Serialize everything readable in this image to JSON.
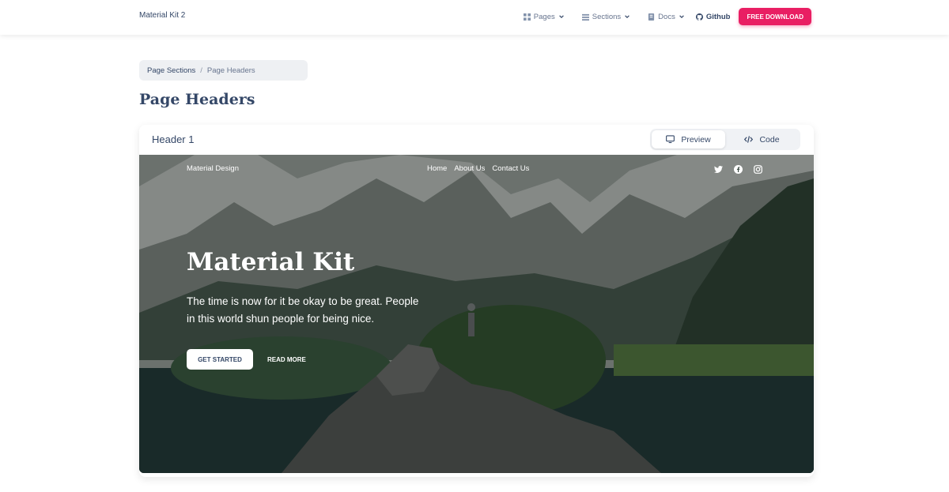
{
  "navbar": {
    "brand": "Material Kit 2",
    "items": [
      {
        "label": "Pages",
        "icon": "grid-icon"
      },
      {
        "label": "Sections",
        "icon": "list-icon"
      },
      {
        "label": "Docs",
        "icon": "book-icon"
      }
    ],
    "github_label": "Github",
    "download_label": "FREE DOWNLOAD",
    "accent_color": "#e91e63"
  },
  "breadcrumb": {
    "parent": "Page Sections",
    "separator": "/",
    "current": "Page Headers"
  },
  "page": {
    "title": "Page Headers"
  },
  "card": {
    "title": "Header 1",
    "tabs": [
      {
        "label": "Preview",
        "icon": "monitor-icon",
        "active": true
      },
      {
        "label": "Code",
        "icon": "code-icon",
        "active": false
      }
    ]
  },
  "hero": {
    "brand": "Material Design",
    "links": [
      "Home",
      "About Us",
      "Contact Us"
    ],
    "social_icons": [
      "twitter-icon",
      "facebook-icon",
      "instagram-icon"
    ],
    "title": "Material Kit",
    "text": "The time is now for it be okay to be great. People in this world shun people for being nice.",
    "primary_button": "GET STARTED",
    "secondary_button": "READ MORE"
  }
}
